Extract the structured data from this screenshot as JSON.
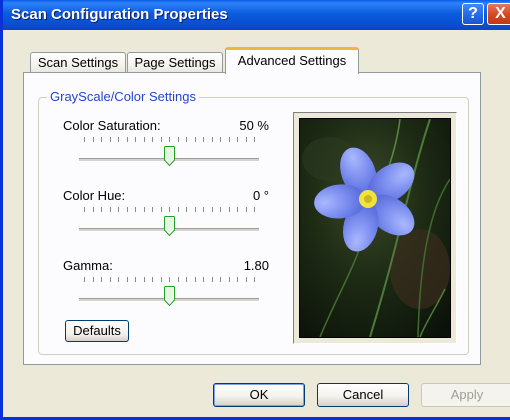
{
  "window": {
    "title": "Scan Configuration Properties",
    "help_label": "?",
    "close_label": "X"
  },
  "tabs": [
    {
      "label": "Scan Settings",
      "selected": false
    },
    {
      "label": "Page Settings",
      "selected": false
    },
    {
      "label": "Advanced Settings",
      "selected": true
    }
  ],
  "group": {
    "title": "GrayScale/Color Settings",
    "sliders": [
      {
        "label": "Color Saturation:",
        "value": "50 %",
        "position": 0.5
      },
      {
        "label": "Color Hue:",
        "value": "0 °",
        "position": 0.5
      },
      {
        "label": "Gamma:",
        "value": "1.80",
        "position": 0.5
      }
    ],
    "defaults_label": "Defaults"
  },
  "preview": {
    "subject": "blue-flax-flower-photo"
  },
  "buttons": {
    "ok": "OK",
    "cancel": "Cancel",
    "apply": "Apply",
    "apply_enabled": false
  },
  "colors": {
    "titlebar": "#0a5ce8",
    "group_title": "#2146c8",
    "tab_highlight": "#f1b43e",
    "window_bg": "#ece9d8"
  }
}
